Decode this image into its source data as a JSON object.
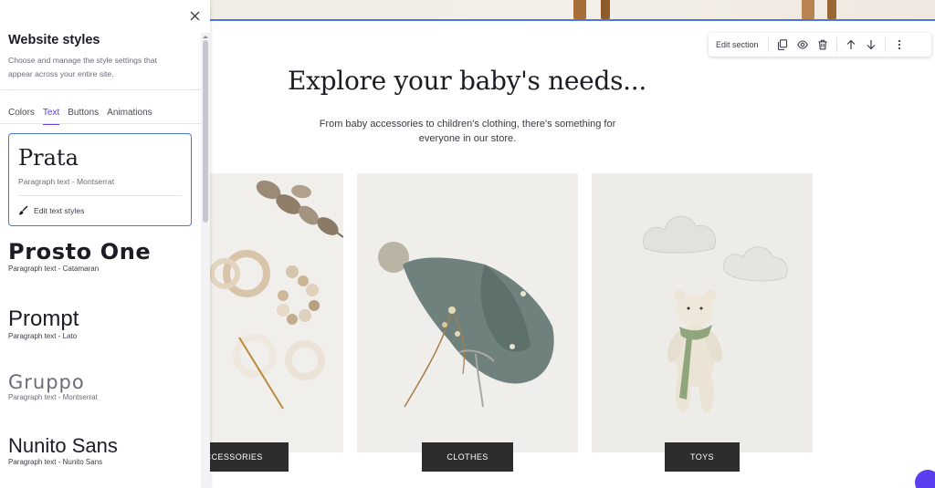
{
  "panel": {
    "title": "Website styles",
    "description": "Choose and manage the style settings that appear across your entire site.",
    "tabs": [
      {
        "label": "Colors"
      },
      {
        "label": "Text"
      },
      {
        "label": "Buttons"
      },
      {
        "label": "Animations"
      }
    ],
    "active_tab": "Text",
    "selected_font": {
      "name": "Prata",
      "paragraph": "Paragraph text - Montserrat",
      "edit_label": "Edit text styles"
    },
    "font_options": [
      {
        "name": "Prosto One",
        "paragraph": "Paragraph text - Catamaran"
      },
      {
        "name": "Prompt",
        "paragraph": "Paragraph text - Lato"
      },
      {
        "name": "Gruppo",
        "paragraph": "Paragraph text - Montserrat"
      },
      {
        "name": "Nunito Sans",
        "paragraph": "Paragraph text - Nunito Sans"
      }
    ]
  },
  "toolbar": {
    "edit_section_label": "Edit section",
    "icons": [
      "duplicate-icon",
      "eye-icon",
      "trash-icon",
      "arrow-up-icon",
      "arrow-down-icon",
      "more-vertical-icon"
    ]
  },
  "canvas": {
    "title": "Explore your baby's needs...",
    "subtitle": "From baby accessories to children's clothing, there's something for everyone in our store.",
    "categories": [
      {
        "label": "ACCESSORIES"
      },
      {
        "label": "CLOTHES"
      },
      {
        "label": "TOYS"
      }
    ]
  },
  "colors": {
    "accent": "#5a3ef0",
    "selection": "#4a78e0",
    "label_bg": "#2d2d2d"
  }
}
